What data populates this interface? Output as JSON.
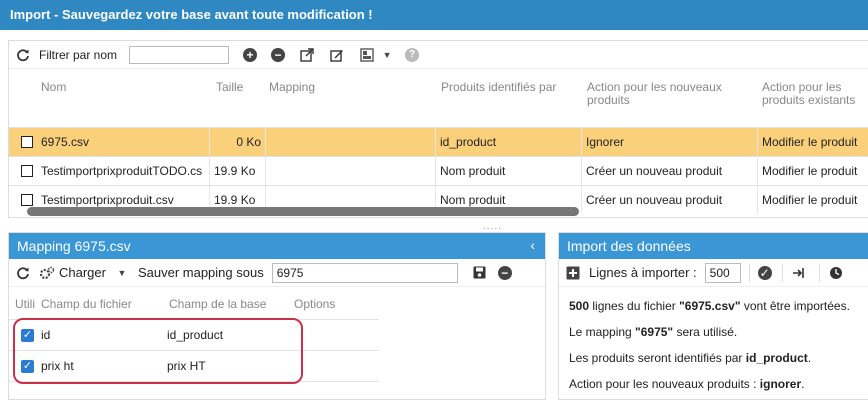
{
  "window": {
    "title": "Import - Sauvegardez votre base avant toute modification !"
  },
  "top_toolbar": {
    "refresh_icon": "refresh-icon",
    "filter_label": "Filtrer par nom",
    "filter_value": "",
    "icons": [
      "add-icon",
      "remove-icon",
      "export-icon",
      "edit-icon",
      "columns-icon",
      "dropdown-icon",
      "help-icon"
    ]
  },
  "files_grid": {
    "columns": [
      "Nom",
      "Taille",
      "Mapping",
      "Produits identifiés par",
      "Action pour les nouveaux produits",
      "Action pour les produits existants"
    ],
    "rows": [
      {
        "name": "6975.csv",
        "size": "0 Ko",
        "mapping": "",
        "identified_by": "id_product",
        "new_action": "Ignorer",
        "existing_action": "Modifier le produit",
        "selected": true
      },
      {
        "name": "TestimportprixproduitTODO.cs",
        "size": "19.9 Ko",
        "mapping": "",
        "identified_by": "Nom produit",
        "new_action": "Créer un nouveau produit",
        "existing_action": "Modifier le produit",
        "selected": false
      },
      {
        "name": "Testimportprixproduit.csv",
        "size": "19.9 Ko",
        "mapping": "",
        "identified_by": "Nom produit",
        "new_action": "Créer un nouveau produit",
        "existing_action": "Modifier le produit",
        "selected": false
      }
    ],
    "splitter_glyph": "....."
  },
  "mapping_panel": {
    "title": "Mapping 6975.csv",
    "collapse_glyph": "‹",
    "load_label": "Charger",
    "save_mapping_label": "Sauver mapping sous",
    "mapping_name": "6975",
    "columns": [
      "Utili",
      "Champ du fichier",
      "Champ de la base",
      "Options"
    ],
    "rows": [
      {
        "file_field": "id",
        "db_field": "id_product",
        "checked": true
      },
      {
        "file_field": "prix ht",
        "db_field": "prix HT",
        "checked": true
      }
    ]
  },
  "import_panel": {
    "title": "Import des données",
    "lines_label": "Lignes à importer :",
    "lines_value": "500",
    "summary": {
      "line1_count": "500",
      "line1_mid": " lignes du fichier ",
      "line1_file": "\"6975.csv\"",
      "line1_end": " vont être importées.",
      "line2_start": "Le mapping ",
      "line2_name": "\"6975\"",
      "line2_end": " sera utilisé.",
      "line3_start": "Les produits seront identifiés par ",
      "line3_field": "id_product",
      "line3_end": ".",
      "line4_start": "Action pour les nouveaux produits : ",
      "line4_action": "ignorer",
      "line4_end": "."
    }
  },
  "colors": {
    "titlebar": "#2f88c2",
    "panel_header": "#3a96d4",
    "selected_row": "#fbd07a",
    "highlight_border": "#c8314a",
    "checkbox": "#2a7cd3"
  }
}
